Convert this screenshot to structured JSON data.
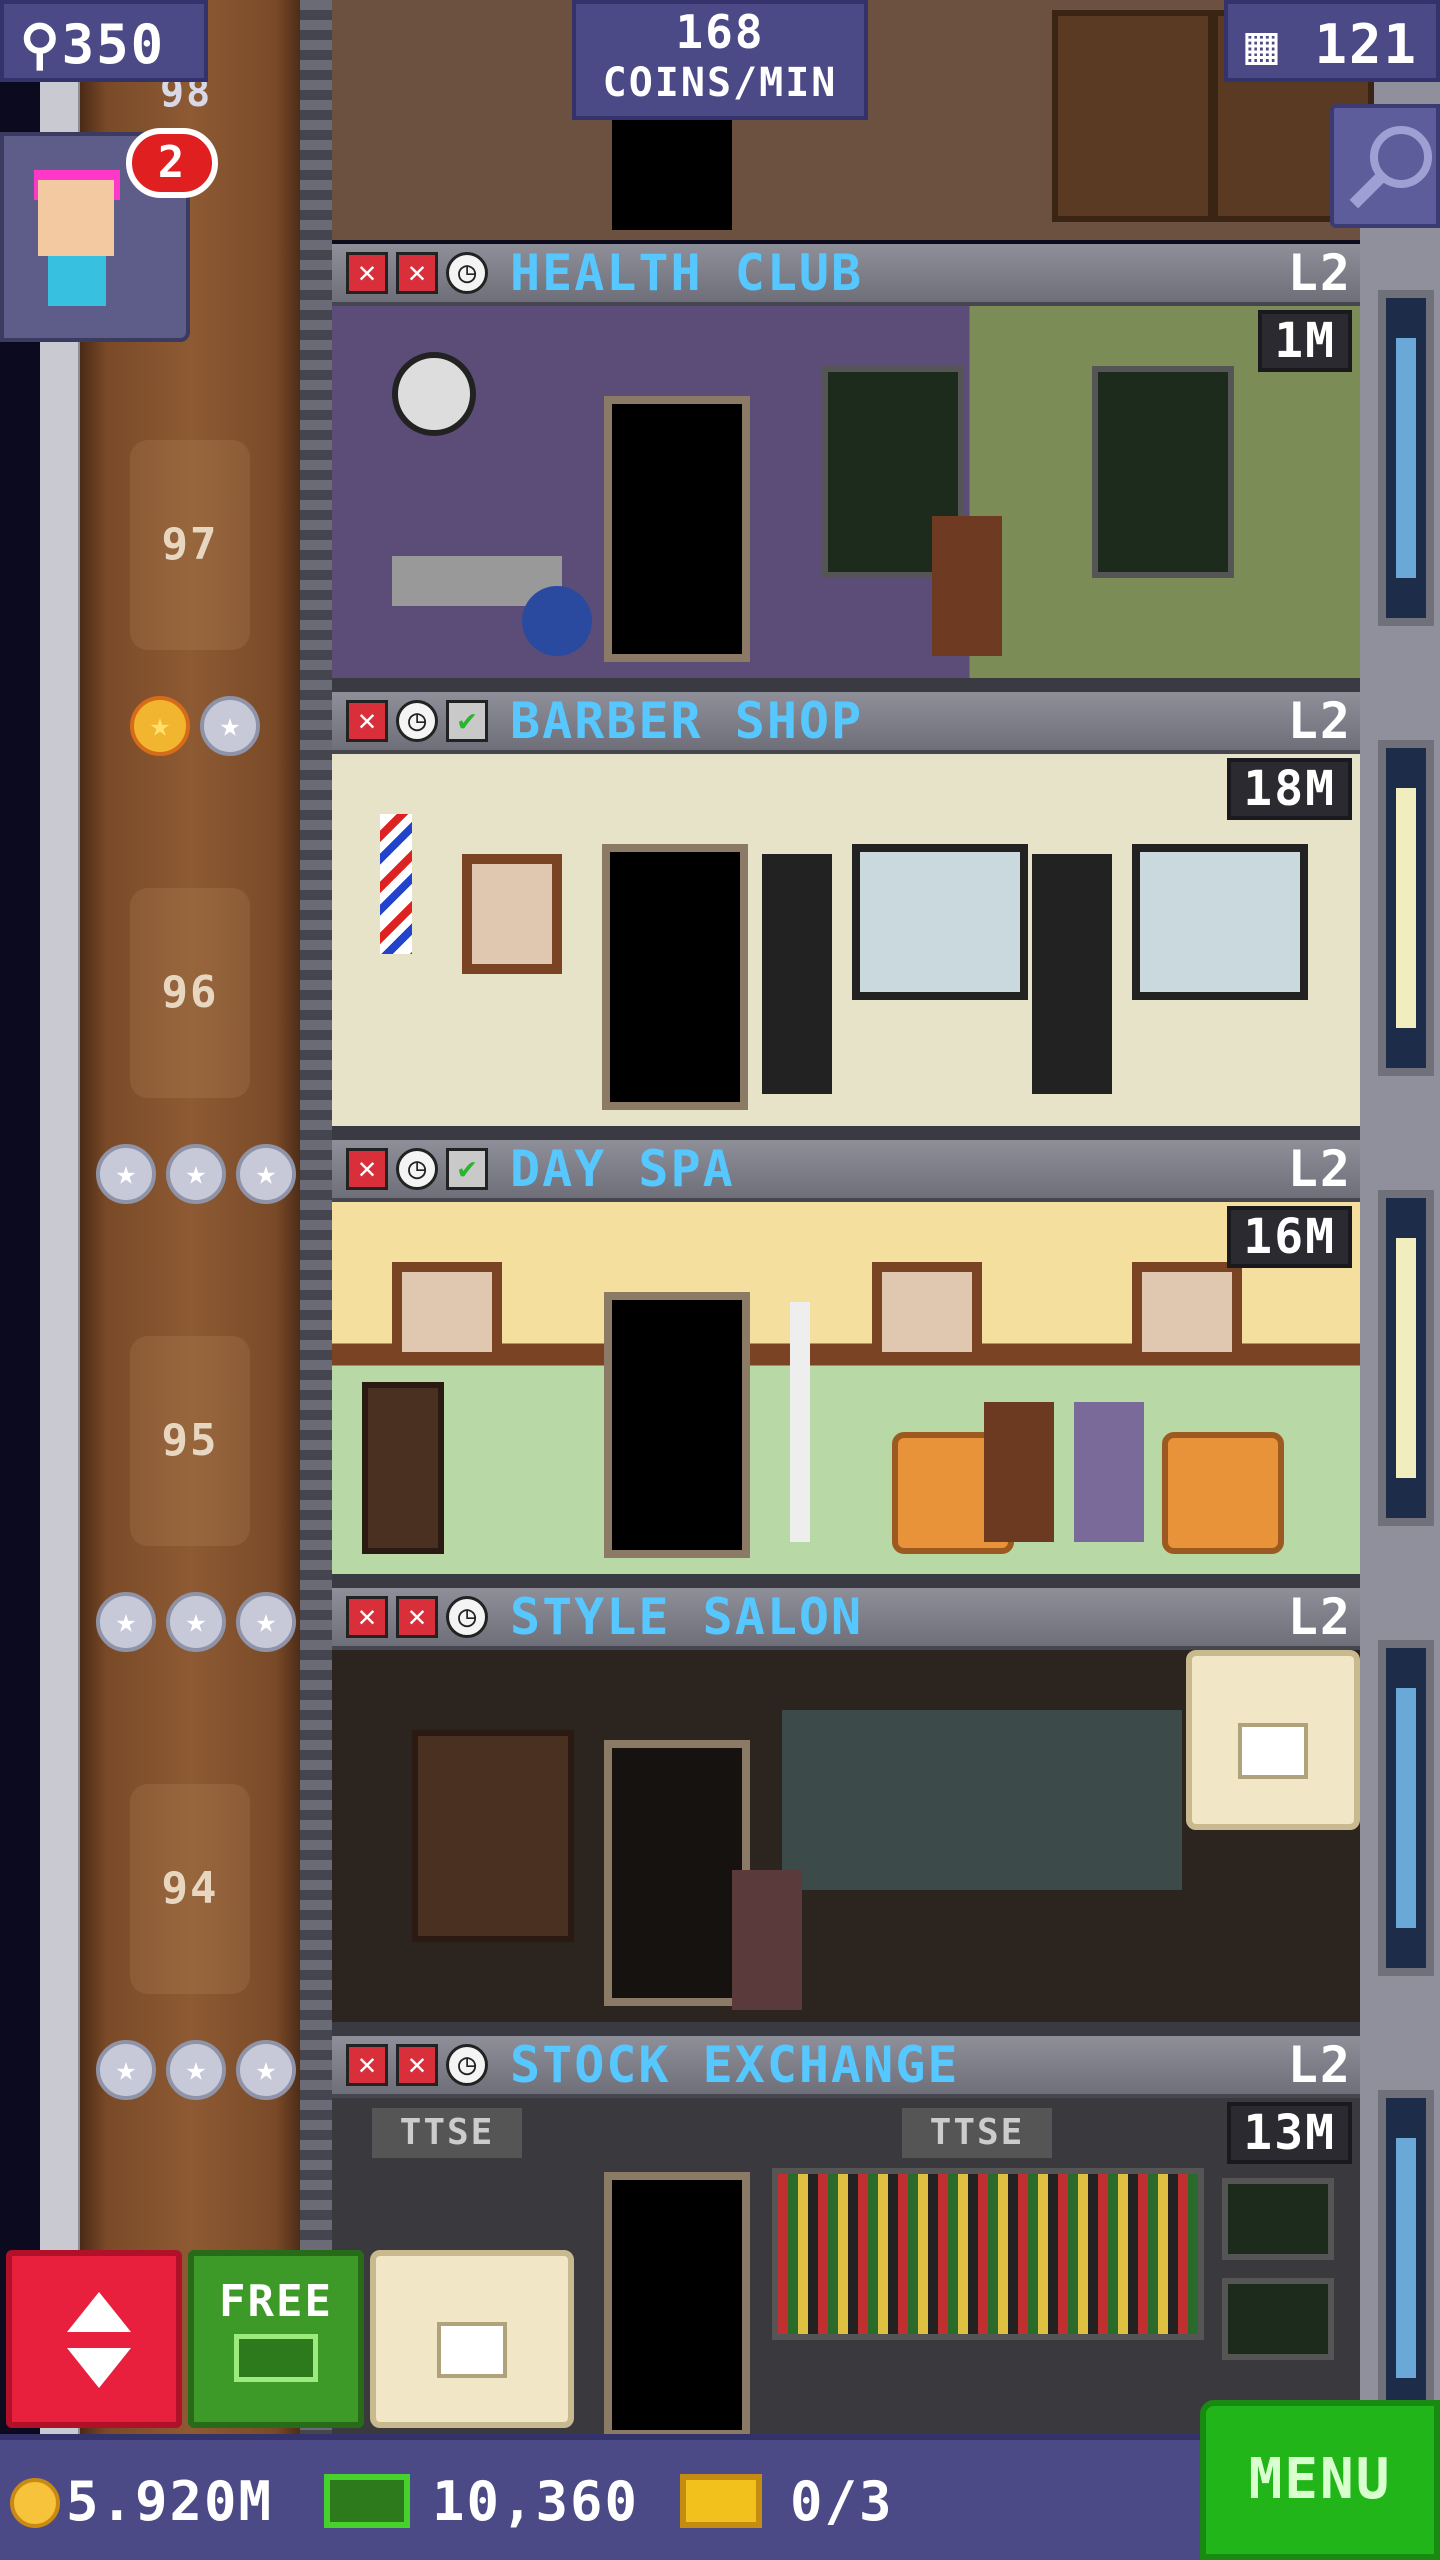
{
  "hud": {
    "population": "350",
    "coin_rate_value": "168",
    "coin_rate_unit": "COINS/MIN",
    "floors_count": "121"
  },
  "visitor": {
    "badge_count": "2"
  },
  "shaft": {
    "floor_top": "98",
    "floor_numbers": [
      "97",
      "96",
      "95",
      "94"
    ],
    "floor_stars": [
      {
        "gold": 1,
        "total": 2
      },
      {
        "gold": 0,
        "total": 3
      },
      {
        "gold": 0,
        "total": 3
      },
      {
        "gold": 0,
        "total": 3
      }
    ]
  },
  "floors": [
    {
      "name": "HEALTH CLUB",
      "level": "L2",
      "earnings": "1M",
      "status": [
        "x",
        "x",
        "clock"
      ]
    },
    {
      "name": "BARBER SHOP",
      "level": "L2",
      "earnings": "18M",
      "status": [
        "x",
        "clock",
        "check"
      ]
    },
    {
      "name": "DAY SPA",
      "level": "L2",
      "earnings": "16M",
      "status": [
        "x",
        "clock",
        "check"
      ]
    },
    {
      "name": "STYLE SALON",
      "level": "L2",
      "earnings": "",
      "status": [
        "x",
        "x",
        "clock"
      ]
    },
    {
      "name": "STOCK EXCHANGE",
      "level": "L2",
      "earnings": "13M",
      "status": [
        "x",
        "x",
        "clock"
      ],
      "signs": [
        "TTSE",
        "TTSE"
      ]
    }
  ],
  "buttons": {
    "free_label": "FREE",
    "menu_label": "MENU"
  },
  "resources": {
    "coins": "5.920M",
    "bux": "10,360",
    "tickets": "0/3"
  },
  "colors": {
    "hud_bg": "#4b4a86",
    "floor_name": "#56c8ff",
    "elevator_button": "#e8203e",
    "free_button": "#3e9a28",
    "menu_button": "#22b51a"
  }
}
